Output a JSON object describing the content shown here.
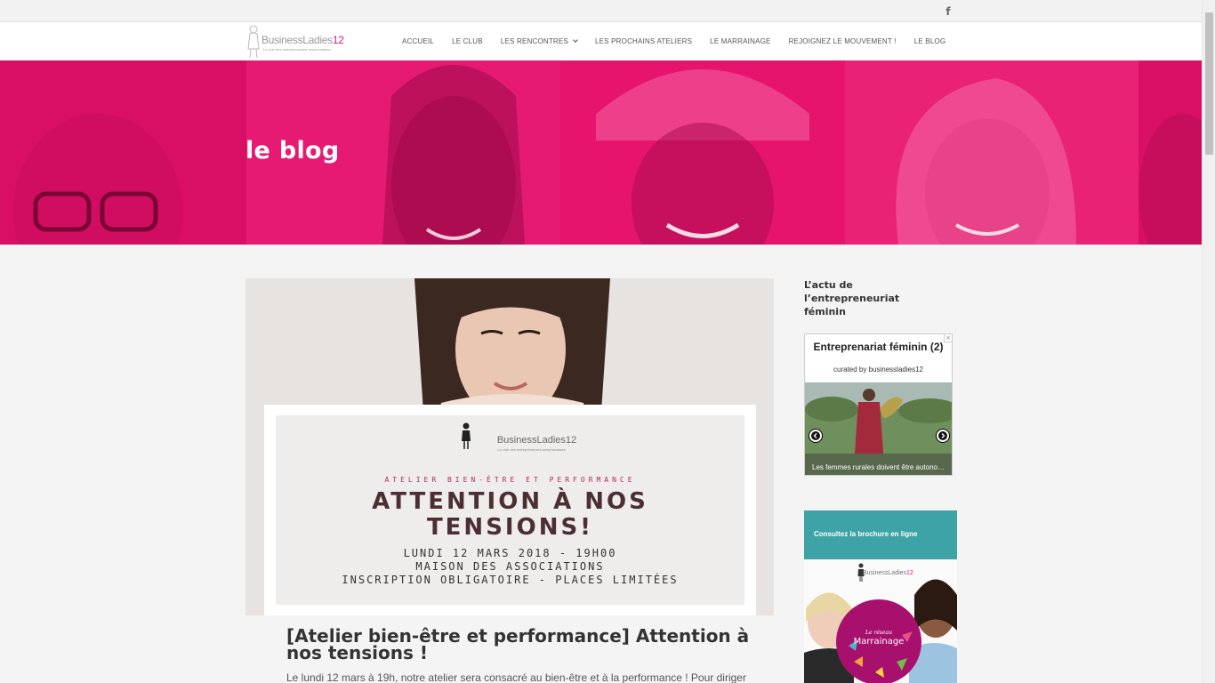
{
  "topbar": {
    "social_icon": "facebook-icon",
    "social_glyph": "f"
  },
  "header": {
    "logo": {
      "brand": "BusinessLadies",
      "brand_number": "12",
      "tagline": "Le club des entrepreneuses aveyronnaises"
    },
    "nav": [
      {
        "label": "Accueil"
      },
      {
        "label": "Le Club"
      },
      {
        "label": "Les rencontres",
        "has_dropdown": true
      },
      {
        "label": "Les prochains ateliers"
      },
      {
        "label": "Le marrainage"
      },
      {
        "label": "Rejoignez le mouvement !"
      },
      {
        "label": "Le blog"
      }
    ]
  },
  "hero": {
    "title": "le blog",
    "background_color": "#e8136e"
  },
  "post": {
    "poster": {
      "brand": "BusinessLadies12",
      "brand_sub": "Le club des entrepreneuses aveyronnaises",
      "kicker": "ATELIER BIEN-ÊTRE ET PERFORMANCE",
      "title_line1": "ATTENTION À NOS",
      "title_line2": "TENSIONS!",
      "line1": "LUNDI 12 MARS 2018 - 19H00",
      "line2": "MAISON DES ASSOCIATIONS",
      "line3": "INSCRIPTION OBLIGATOIRE - PLACES LIMITÉES"
    },
    "title": "[Atelier bien-être et performance] Attention à nos tensions !",
    "excerpt": "Le lundi 12 mars à 19h, notre atelier sera consacré au bien-être et à la performance ! Pour diriger"
  },
  "sidebar": {
    "widget_title": "L’actu de l’entrepreneuriat féminin",
    "scoop": {
      "title": "Entreprenariat féminin (2)",
      "curated_by": "curated by businessladies12",
      "caption": "Les femmes rurales doivent être autonomes",
      "close_glyph": "×"
    },
    "brochure": {
      "banner_text": "Consultez la brochure en ligne",
      "logo_brand": "BusinessLadies",
      "logo_number": "12",
      "circle_small": "Le réseau",
      "circle_big": "Marrainage"
    }
  },
  "colors": {
    "accent": "#e8136e",
    "teal": "#3ea3a6",
    "plum": "#a8106e"
  }
}
